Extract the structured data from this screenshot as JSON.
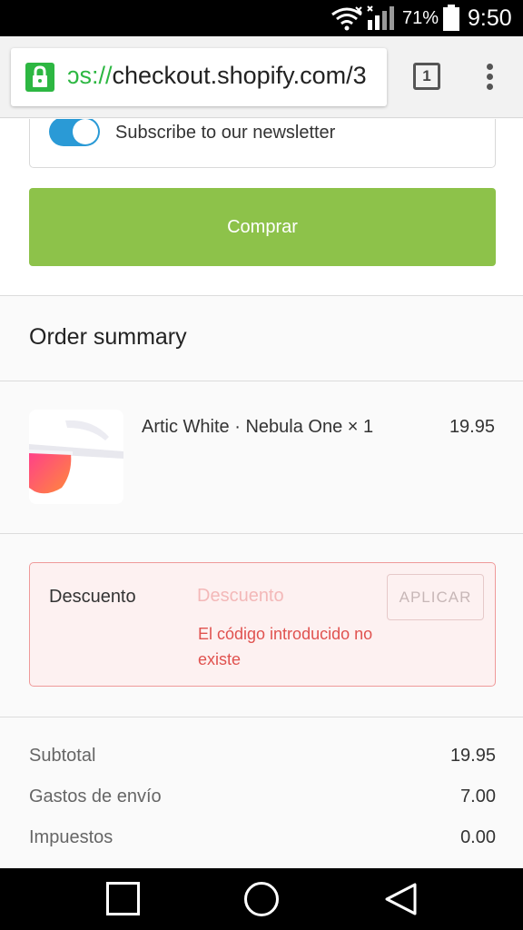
{
  "status_bar": {
    "battery_percent": "71%",
    "time": "9:50"
  },
  "browser": {
    "url_scheme": "ɔs://",
    "url_host": "checkout.shopify.com/3",
    "tab_count": "1"
  },
  "checkout": {
    "newsletter_label": "Subscribe to our newsletter",
    "newsletter_checked": true,
    "buy_button_label": "Comprar",
    "buy_button_color": "#8dc24a",
    "order_summary_title": "Order summary",
    "product": {
      "name": "Artic White · Nebula One × 1",
      "price": "19.95"
    },
    "discount": {
      "label": "Descuento",
      "placeholder": "Descuento",
      "value": "",
      "apply_label": "APLICAR",
      "error": "El código introducido no existe",
      "error_color": "#e0524f"
    },
    "totals": [
      {
        "label": "Subtotal",
        "value": "19.95"
      },
      {
        "label": "Gastos de envío",
        "value": "7.00"
      },
      {
        "label": "Impuestos",
        "value": "0.00"
      }
    ]
  }
}
